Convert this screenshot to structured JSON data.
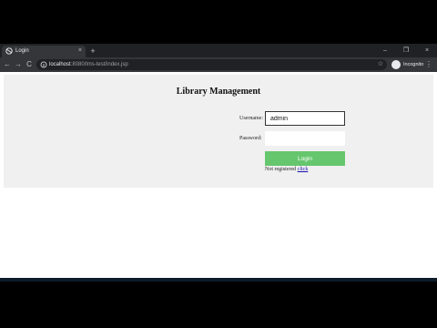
{
  "browser": {
    "tab": {
      "title": "Login",
      "close": "×"
    },
    "new_tab": "+",
    "window": {
      "minimize": "–",
      "maximize": "❐",
      "close": "×"
    },
    "nav": {
      "back": "←",
      "forward": "→",
      "reload": "C"
    },
    "url": {
      "host": "localhost",
      "rest": ":8080/lms-test/index.jsp"
    },
    "star": "☆",
    "profile": "Incognito",
    "menu": "⋮"
  },
  "page": {
    "title": "Library Management",
    "username_label": "Username:",
    "username_value": "admin",
    "password_label": "Password:",
    "login_button": "Login",
    "register_text": "Not registered",
    "register_link": "click"
  },
  "colors": {
    "login_button": "#66c66e",
    "panel": "#f0f0f0",
    "browser_dark": "#35363a"
  }
}
